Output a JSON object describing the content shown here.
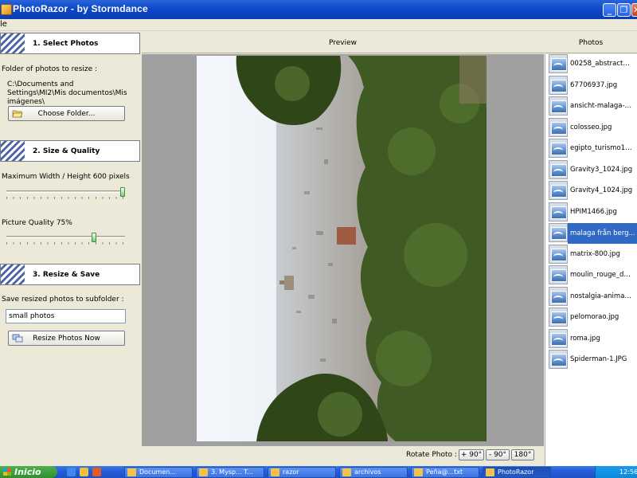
{
  "window": {
    "title": "PhotoRazor - by Stormdance",
    "controls": [
      "minimize",
      "maximize",
      "close"
    ]
  },
  "menu": {
    "file_label": "le"
  },
  "step1": {
    "title": "1. Select Photos",
    "folder_label": "Folder of photos to resize :",
    "folder_path": "C:\\Documents and Settings\\MI2\\Mis documentos\\Mis imágenes\\",
    "choose_button": "Choose Folder..."
  },
  "step2": {
    "title": "2. Size & Quality",
    "size_label": "Maximum Width / Height 600 pixels",
    "size_level": 1.0,
    "quality_label": "Picture Quality 75%",
    "quality_level": 0.75
  },
  "step3": {
    "title": "3. Resize & Save",
    "subfolder_label": "Save resized photos to subfolder :",
    "subfolder_value": "small photos",
    "resize_button": "Resize Photos Now"
  },
  "preview": {
    "header": "Preview",
    "rotate_label": "Rotate Photo :",
    "rotate_buttons": [
      "+ 90°",
      "- 90°",
      "180°"
    ]
  },
  "photos": {
    "header": "Photos",
    "selected_index": 8,
    "items": [
      "00258_abstractb...",
      "67706937.jpg",
      "ansicht-malaga-c...",
      "colosseo.jpg",
      "egipto_turismo11...",
      "Gravity3_1024.jpg",
      "Gravity4_1024.jpg",
      "HPIM1466.jpg",
      "malaga från berg...",
      "matrix-800.jpg",
      "moulin_rouge_de...",
      "nostalgia-animad...",
      "pelomorao.jpg",
      "roma.jpg",
      "Spiderman-1.JPG"
    ]
  },
  "taskbar": {
    "start_label": "Inicio",
    "tasks": [
      "Documen...",
      "3. Mysp... T...",
      "razor",
      "archivos",
      "Peña@...txt",
      "PhotoRazor"
    ],
    "clock": "12:56"
  },
  "colors": {
    "titlebar": "#0a47c8",
    "selection": "#316ac5",
    "preview_bg": "#a0a0a0",
    "slider_thumb": "#7ec47e"
  }
}
